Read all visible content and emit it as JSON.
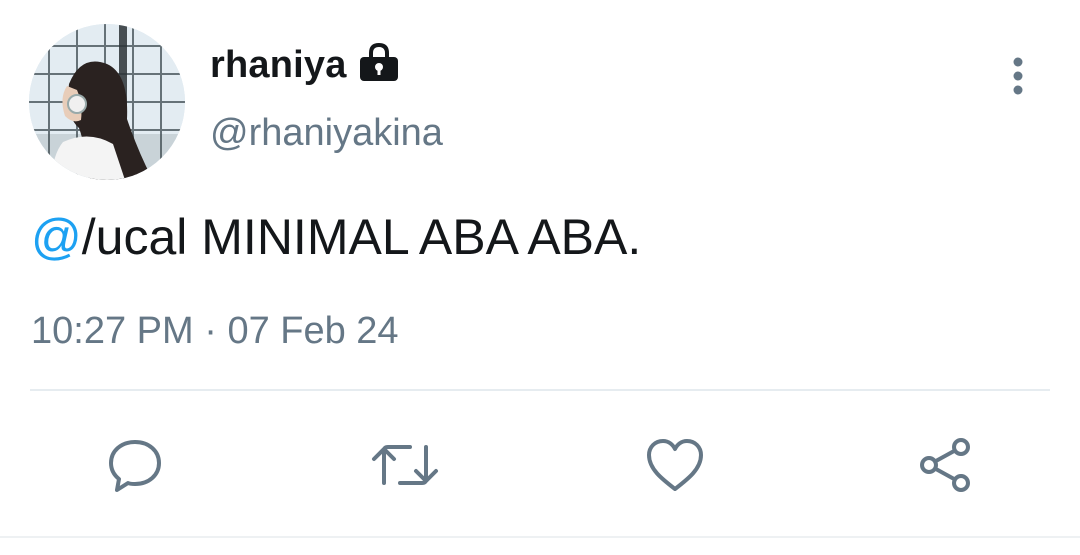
{
  "author": {
    "display_name": "rhaniya",
    "handle": "@rhaniyakina",
    "protected_icon": "lock-icon",
    "avatar": "profile-photo"
  },
  "tweet": {
    "mention": "@",
    "text": "/ucal MINIMAL ABA ABA.",
    "time": "10:27 PM",
    "separator": " · ",
    "date": "07 Feb 24"
  },
  "actions": [
    {
      "name": "reply",
      "icon": "speech-bubble-icon"
    },
    {
      "name": "retweet",
      "icon": "retweet-arrows-icon"
    },
    {
      "name": "like",
      "icon": "heart-icon"
    },
    {
      "name": "share",
      "icon": "share-icon"
    }
  ],
  "menu_icon": "vertical-ellipsis-icon",
  "colors": {
    "text": "#14171a",
    "secondary": "#657786",
    "mention": "#1da1f2",
    "divider": "#e6ecf0"
  }
}
